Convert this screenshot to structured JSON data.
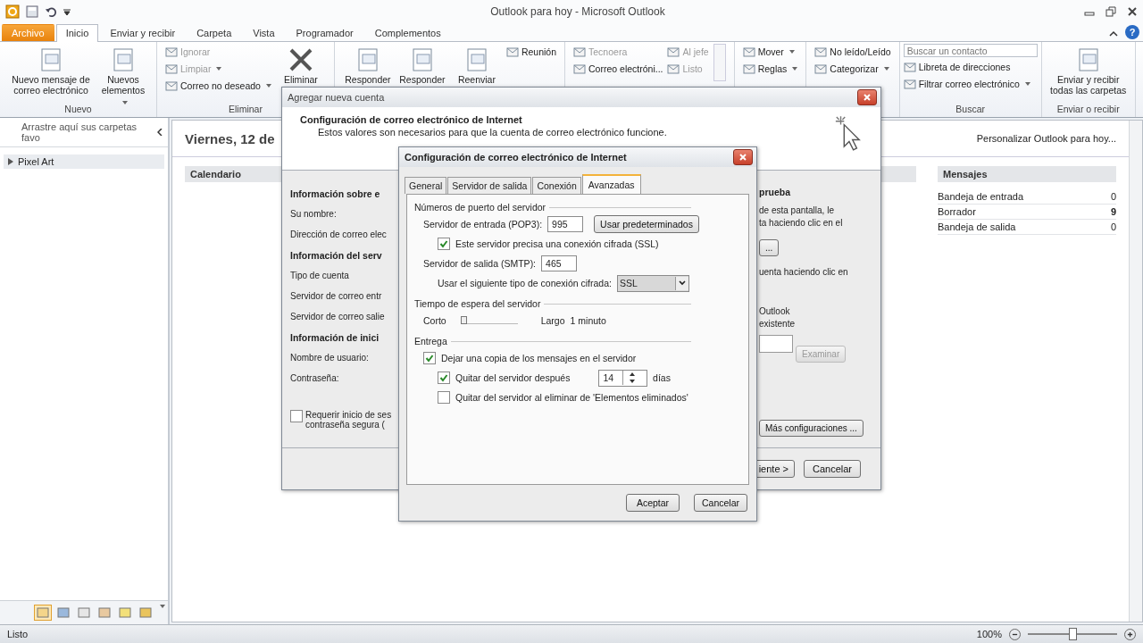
{
  "window": {
    "title": "Outlook para hoy - Microsoft Outlook",
    "help_glyph": "?"
  },
  "ribbon_tabs": [
    {
      "label": "Archivo",
      "kind": "backstage",
      "selected": false
    },
    {
      "label": "Inicio",
      "kind": "tab",
      "selected": true
    },
    {
      "label": "Enviar y recibir",
      "kind": "tab",
      "selected": false
    },
    {
      "label": "Carpeta",
      "kind": "tab",
      "selected": false
    },
    {
      "label": "Vista",
      "kind": "tab",
      "selected": false
    },
    {
      "label": "Programador",
      "kind": "tab",
      "selected": false
    },
    {
      "label": "Complementos",
      "kind": "tab",
      "selected": false
    }
  ],
  "ribbon_groups": [
    {
      "label": "Nuevo",
      "columns": [
        [
          {
            "kind": "large",
            "label": "Nuevo mensaje de correo electrónico",
            "dropdown": false
          }
        ],
        [
          {
            "kind": "large",
            "label": "Nuevos elementos",
            "dropdown": true
          }
        ]
      ]
    },
    {
      "label": "Eliminar",
      "columns": [
        [
          {
            "kind": "small",
            "label": "Ignorar",
            "disabled": true,
            "dropdown": false
          },
          {
            "kind": "small",
            "label": "Limpiar",
            "disabled": true,
            "dropdown": true
          },
          {
            "kind": "small",
            "label": "Correo no deseado",
            "disabled": false,
            "dropdown": true
          }
        ],
        [
          {
            "kind": "delete",
            "label": "Eliminar"
          }
        ]
      ]
    },
    {
      "columns": [
        [
          {
            "kind": "large",
            "label": "Responder",
            "dropdown": false
          }
        ],
        [
          {
            "kind": "large",
            "label": "Responder",
            "dropdown": false
          }
        ],
        [
          {
            "kind": "large",
            "label": "Reenviar",
            "dropdown": false
          }
        ],
        [
          {
            "kind": "small",
            "label": "Reunión",
            "disabled": false,
            "dropdown": false
          }
        ]
      ]
    },
    {
      "columns": [
        [
          {
            "kind": "small",
            "label": "Tecnoera",
            "disabled": true,
            "dropdown": false
          },
          {
            "kind": "small",
            "label": "Correo electróni...",
            "disabled": false,
            "dropdown": false
          }
        ],
        [
          {
            "kind": "small",
            "label": "Al jefe",
            "disabled": true,
            "dropdown": false
          },
          {
            "kind": "small",
            "label": "Listo",
            "disabled": true,
            "dropdown": false
          }
        ],
        [
          {
            "kind": "gallery_scroll"
          }
        ]
      ]
    },
    {
      "columns": [
        [
          {
            "kind": "small",
            "label": "Mover",
            "disabled": false,
            "dropdown": true
          },
          {
            "kind": "small",
            "label": "Reglas",
            "disabled": false,
            "dropdown": true
          }
        ]
      ]
    },
    {
      "columns": [
        [
          {
            "kind": "small",
            "label": "No leído/Leído",
            "disabled": false,
            "dropdown": false
          },
          {
            "kind": "small",
            "label": "Categorizar",
            "disabled": false,
            "dropdown": true
          }
        ]
      ]
    },
    {
      "label": "Buscar",
      "columns": [
        [
          {
            "kind": "field",
            "placeholder": "Buscar un contacto"
          },
          {
            "kind": "small",
            "label": "Libreta de direcciones",
            "disabled": false,
            "dropdown": false
          },
          {
            "kind": "small",
            "label": "Filtrar correo electrónico",
            "disabled": false,
            "dropdown": true
          }
        ]
      ]
    },
    {
      "label": "Enviar o recibir",
      "columns": [
        [
          {
            "kind": "large",
            "label": "Enviar y recibir todas las carpetas",
            "dropdown": false
          }
        ]
      ]
    }
  ],
  "navigation": {
    "favorites_hint": "Arrastre aquí sus carpetas favo",
    "folders": [
      {
        "label": "Pixel Art",
        "expanded": false
      }
    ],
    "nav_buttons": [
      {
        "selected": true
      },
      {
        "selected": false
      },
      {
        "selected": false
      },
      {
        "selected": false
      },
      {
        "selected": false
      },
      {
        "selected": false
      }
    ]
  },
  "today": {
    "date": "Viernes, 12 de",
    "customize_link": "Personalizar Outlook para hoy...",
    "calendar_header": "Calendario",
    "messages_header": "Mensajes",
    "messages": [
      {
        "label": "Bandeja de entrada",
        "count": "0",
        "unread": false
      },
      {
        "label": "Borrador",
        "count": "9",
        "unread": true
      },
      {
        "label": "Bandeja de salida",
        "count": "0",
        "unread": false
      }
    ]
  },
  "status_bar": {
    "text": "Listo",
    "zoom": "100%",
    "level": 0.5
  },
  "add_account_dialog": {
    "title": "Agregar nueva cuenta",
    "heading": "Configuración de correo electrónico de Internet",
    "subtitle": "Estos valores son necesarios para que la cuenta de correo electrónico funcione.",
    "left": [
      {
        "kind": "heading",
        "text": "Información sobre e"
      },
      {
        "kind": "label",
        "text": "Su nombre:"
      },
      {
        "kind": "label",
        "text": "Dirección de correo elec"
      },
      {
        "kind": "heading",
        "text": "Información del serv"
      },
      {
        "kind": "label",
        "text": "Tipo de cuenta"
      },
      {
        "kind": "label",
        "text": "Servidor de correo entr"
      },
      {
        "kind": "label",
        "text": "Servidor de correo salie"
      },
      {
        "kind": "heading",
        "text": "Información de inici"
      },
      {
        "kind": "label",
        "text": "Nombre de usuario:"
      },
      {
        "kind": "label",
        "text": "Contraseña:"
      },
      {
        "kind": "checkbox",
        "text": "Requerir inicio de ses",
        "text2": "contraseña segura (",
        "checked": false
      }
    ],
    "right": [
      {
        "kind": "heading",
        "text": "prueba"
      },
      {
        "kind": "paragraph",
        "text": "de esta pantalla, le"
      },
      {
        "kind": "paragraph",
        "text": "ta haciendo clic en el"
      },
      {
        "kind": "button",
        "text": "..."
      },
      {
        "kind": "paragraph",
        "text": "uenta haciendo clic en"
      },
      {
        "kind": "paragraph",
        "text": "Outlook"
      },
      {
        "kind": "paragraph",
        "text": "existente"
      },
      {
        "kind": "browse",
        "text": "Examinar",
        "disabled": true
      },
      {
        "kind": "button",
        "text": "Más configuraciones ..."
      }
    ],
    "buttons": [
      "iente >",
      "Cancelar"
    ]
  },
  "settings_dialog": {
    "title": "Configuración de correo electrónico de Internet",
    "tabs": [
      {
        "label": "General",
        "selected": false
      },
      {
        "label": "Servidor de salida",
        "selected": false
      },
      {
        "label": "Conexión",
        "selected": false
      },
      {
        "label": "Avanzadas",
        "selected": true
      }
    ],
    "sections": [
      {
        "title": "Números de puerto del servidor",
        "rows": [
          {
            "kind": "port",
            "label": "Servidor de entrada (POP3):",
            "value": "995",
            "button": "Usar predeterminados",
            "children": [
              {
                "kind": "checkbox",
                "label": "Este servidor precisa una conexión cifrada (SSL)",
                "checked": true
              }
            ]
          },
          {
            "kind": "port",
            "label": "Servidor de salida (SMTP):",
            "value": "465",
            "children": [
              {
                "kind": "select",
                "label": "Usar el siguiente tipo de conexión cifrada:",
                "value": "SSL"
              }
            ]
          }
        ]
      },
      {
        "title": "Tiempo de espera del servidor",
        "rows": [
          {
            "kind": "slider",
            "min_label": "Corto",
            "max_label": "Largo",
            "reading": "1 minuto",
            "level": 0.05
          }
        ]
      },
      {
        "title": "Entrega",
        "rows": [
          {
            "kind": "checkbox",
            "label": "Dejar una copia de los mensajes en el servidor",
            "checked": true,
            "children": [
              {
                "kind": "spinner",
                "label": "Quitar del servidor después",
                "checked": true,
                "value": "14",
                "unit": "días"
              },
              {
                "kind": "checkbox",
                "label": "Quitar del servidor al eliminar de 'Elementos eliminados'",
                "checked": false
              }
            ]
          }
        ]
      }
    ],
    "buttons": [
      "Aceptar",
      "Cancelar"
    ]
  }
}
